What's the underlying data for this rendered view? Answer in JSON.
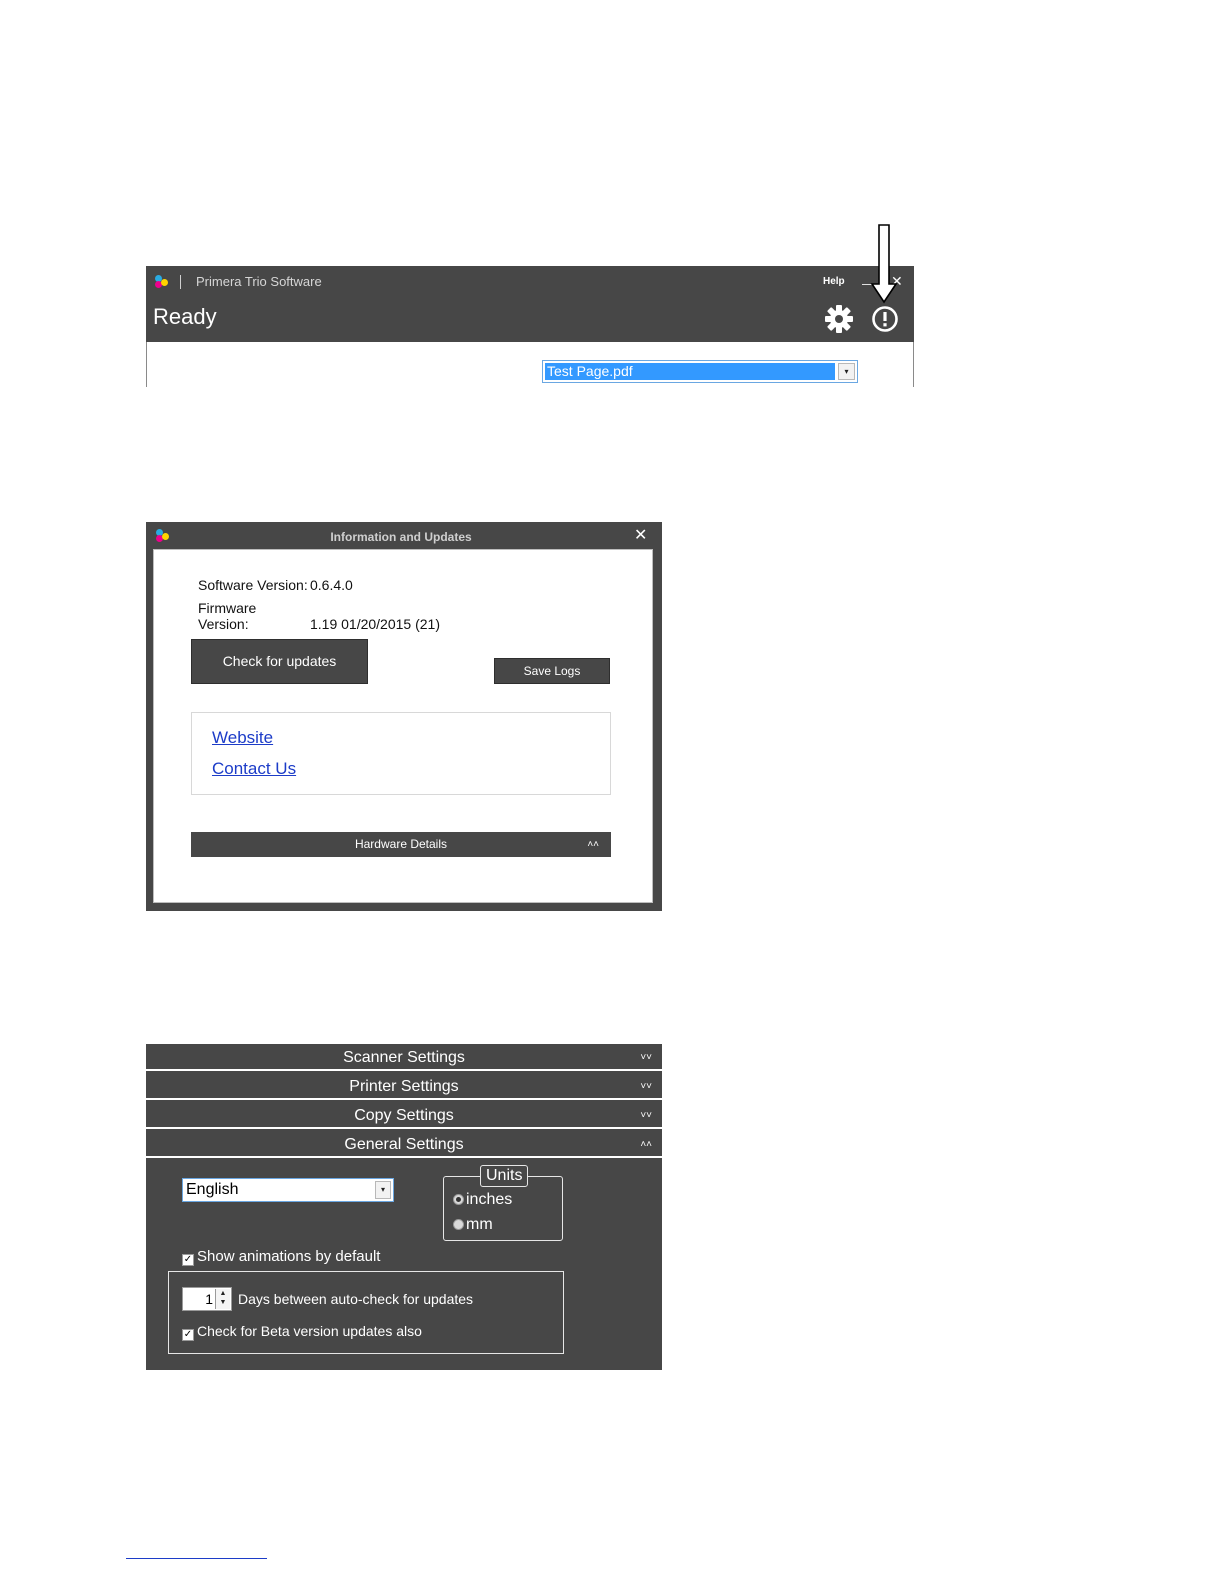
{
  "main_window": {
    "app_title": "Primera Trio Software",
    "help_label": "Help",
    "minimize_label": "_",
    "close_label": "✕",
    "status": "Ready",
    "file_select_value": "Test Page.pdf",
    "dropdown_arrow": "▾",
    "icons": [
      "settings-gear-icon",
      "info-alert-icon"
    ]
  },
  "info_dialog": {
    "title": "Information and Updates",
    "close_label": "✕",
    "software_version_label": "Software Version:",
    "software_version_value": "0.6.4.0",
    "firmware_version_label": "Firmware Version:",
    "firmware_version_value": "1.19 01/20/2015  (21)",
    "check_updates_label": "Check for updates",
    "save_logs_label": "Save Logs",
    "links": {
      "website": "Website",
      "contact": "Contact Us"
    },
    "hardware_details_label": "Hardware Details",
    "collapse_icon": "˄˄"
  },
  "settings": {
    "sections": [
      {
        "label": "Scanner Settings",
        "chevron": "˅˅"
      },
      {
        "label": "Printer Settings",
        "chevron": "˅˅"
      },
      {
        "label": "Copy Settings",
        "chevron": "˅˅"
      },
      {
        "label": "General Settings",
        "chevron": "˄˄"
      }
    ],
    "general": {
      "language": "English",
      "units_legend": "Units",
      "unit_inches": "inches",
      "unit_mm": "mm",
      "units_selected": "inches",
      "show_animations_label": "Show animations by default",
      "show_animations_checked": true,
      "days_value": "1",
      "days_label": "Days between auto-check for updates",
      "beta_label": "Check for Beta version updates also",
      "beta_checked": true,
      "check_mark": "✓"
    }
  },
  "colors": {
    "titlebar": "#474747",
    "selection_blue": "#3399ff",
    "link_blue": "#1c3cc8",
    "logo_cyan": "#29abe2",
    "logo_magenta": "#ec008c",
    "logo_yellow": "#ffd400"
  }
}
